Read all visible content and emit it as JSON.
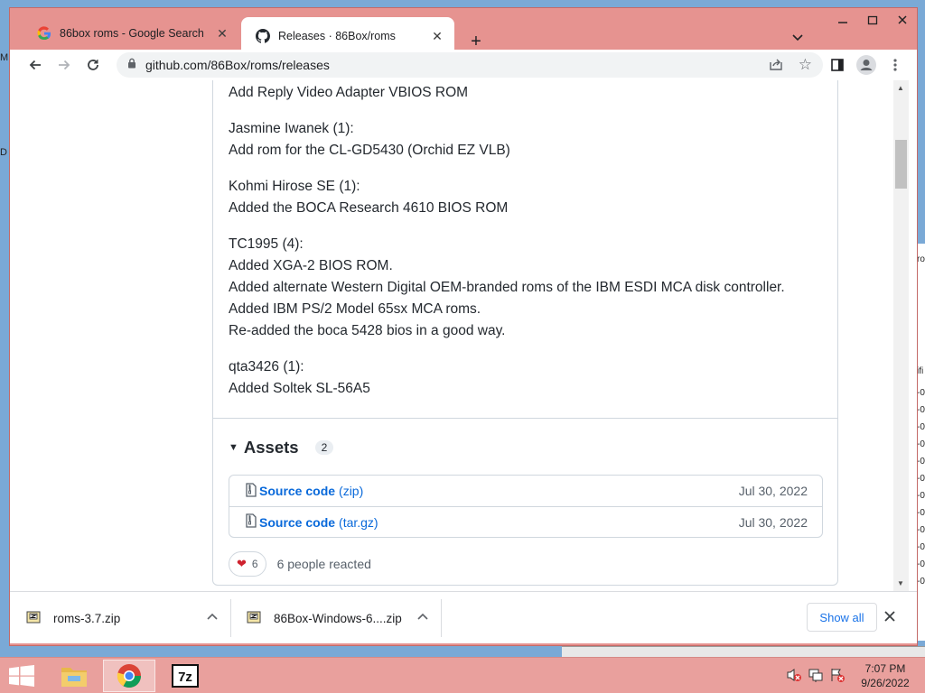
{
  "browser": {
    "tabs": [
      {
        "title": "86box roms - Google Search",
        "active": false,
        "favicon": "google-icon"
      },
      {
        "title": "Releases · 86Box/roms",
        "active": true,
        "favicon": "github-icon"
      }
    ],
    "url": "github.com/86Box/roms/releases"
  },
  "desktop": {
    "left_a": "M",
    "left_b": "D",
    "right_header": "ifi",
    "right_rows": [
      "-0",
      "-0",
      "-0",
      "-0",
      "-0",
      "-0",
      "-0",
      "-0",
      "-0",
      "-0",
      "-0",
      "-0"
    ],
    "right_top": "ro"
  },
  "release": {
    "notes": [
      {
        "lines": [
          "Add Reply Video Adapter VBIOS ROM"
        ]
      },
      {
        "lines": [
          "Jasmine Iwanek (1):",
          "Add rom for the CL-GD5430 (Orchid EZ VLB)"
        ]
      },
      {
        "lines": [
          "Kohmi Hirose SE (1):",
          "Added the BOCA Research 4610 BIOS ROM"
        ]
      },
      {
        "lines": [
          "TC1995 (4):",
          "Added XGA-2 BIOS ROM.",
          "Added alternate Western Digital OEM-branded roms of the IBM ESDI MCA disk controller.",
          "Added IBM PS/2 Model 65sx MCA roms.",
          "Re-added the boca 5428 bios in a good way."
        ]
      },
      {
        "lines": [
          "qta3426 (1):",
          "Added Soltek SL-56A5"
        ]
      }
    ],
    "assets": {
      "label": "Assets",
      "count": "2",
      "items": [
        {
          "name": "Source code",
          "ext": "(zip)",
          "date": "Jul 30, 2022"
        },
        {
          "name": "Source code",
          "ext": "(tar.gz)",
          "date": "Jul 30, 2022"
        }
      ]
    },
    "reactions": {
      "count": "6",
      "text": "6 people reacted"
    }
  },
  "downloads": {
    "items": [
      {
        "name": "roms-3.7.zip"
      },
      {
        "name": "86Box-Windows-6....zip"
      }
    ],
    "show_all": "Show all"
  },
  "taskbar": {
    "time": "7:07 PM",
    "date": "9/26/2022",
    "apps": [
      "file-explorer-icon",
      "chrome-icon",
      "7zip-icon"
    ]
  },
  "colors": {
    "window_frame": "#e69390",
    "link": "#0969da",
    "heart": "#cf222e"
  }
}
